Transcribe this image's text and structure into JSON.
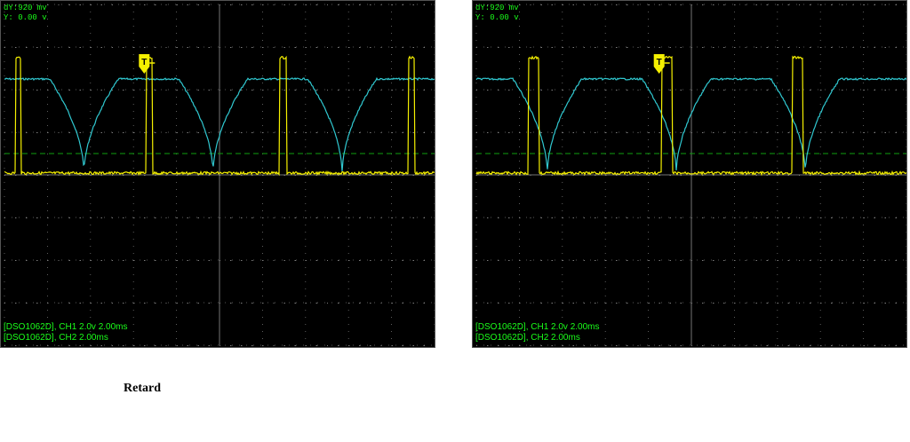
{
  "scopes": [
    {
      "readout_dy": "dY:920 mv",
      "readout_y": "Y:  0.00 v",
      "ch1_status": "[DSO1062D], CH1 2.0v 2.00ms",
      "ch2_status": "[DSO1062D], CH2 2.00ms",
      "trigger_label": "T",
      "pulses_ms": [
        [
          1.0,
          1.5
        ],
        [
          13.2,
          13.8
        ],
        [
          25.6,
          26.2
        ],
        [
          37.6,
          38.1
        ]
      ],
      "dips_ms": [
        7.4,
        19.4,
        31.4
      ],
      "trigger_ms": 13.0
    },
    {
      "readout_dy": "dY:920 mv",
      "readout_y": "Y:  0.00 v",
      "ch1_status": "[DSO1062D], CH1 2.0v 2.00ms",
      "ch2_status": "[DSO1062D], CH2 2.00ms",
      "trigger_label": "T",
      "pulses_ms": [
        [
          4.8,
          5.8
        ],
        [
          17.2,
          18.2
        ],
        [
          29.4,
          30.4
        ]
      ],
      "dips_ms": [
        6.6,
        18.6,
        30.6
      ],
      "trigger_ms": 17.0
    }
  ],
  "caption": "Retard",
  "colors": {
    "ch1": "#f5f000",
    "ch2": "#30c8d0",
    "grid": "#808080",
    "cursor": "#10a010",
    "text": "#1aff1a"
  }
}
